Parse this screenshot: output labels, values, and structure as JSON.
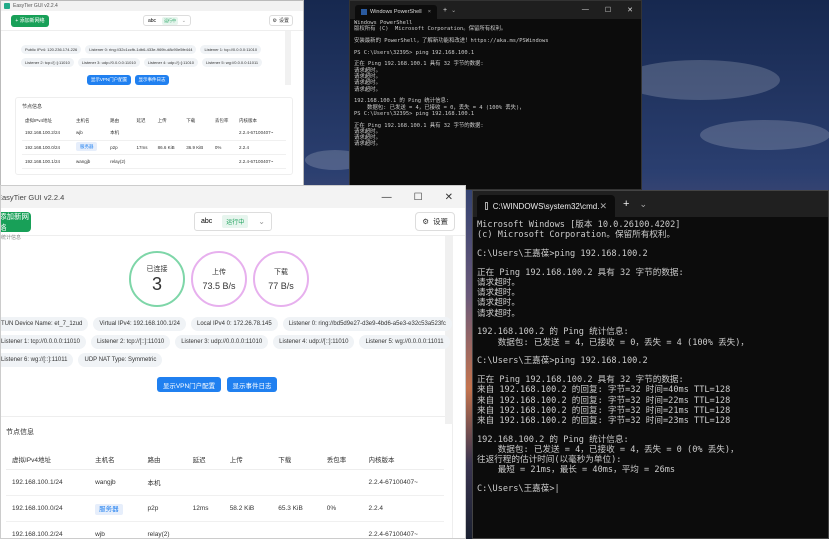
{
  "w1": {
    "title": "EasyTier GUI v2.2.4",
    "add_button": "+ 添加新网络",
    "network": "abc",
    "status": "运行中",
    "settings": "设置",
    "tags_row1": [
      "Public IPv4: 120.236.174.226",
      "Listener 0: ring://32c1ccfb-1db6-433e-969b-d8c90e5fe444",
      "Listener 1: tcp://0.0.0.0:11010"
    ],
    "tags_row2": [
      "Listener 2: tcp://[::]:11010",
      "Listener 3: udp://0.0.0.0:11010",
      "Listener 4: udp://[::]:11010",
      "Listener 5: wg://0.0.0.0:11011"
    ],
    "btn_portal": "显示VPN门户配置",
    "btn_log": "显示事件日志",
    "node_info": "节点信息",
    "headers": [
      "虚拟IPv4地址",
      "主机名",
      "路由",
      "延迟",
      "上传",
      "下载",
      "丢包率",
      "内核版本"
    ],
    "rows": [
      [
        "192.168.100.2/24",
        "wjb",
        "本机",
        "",
        "",
        "",
        "",
        "2.2.4-67100407~"
      ],
      [
        "192.168.100.0/24",
        "服务器",
        "p2p",
        "17ms",
        "86.6 KiB",
        "36.9 KiB",
        "0%",
        "2.2.4"
      ],
      [
        "192.168.100.1/24",
        "wangjb",
        "relay(2)",
        "",
        "",
        "",
        "",
        "2.2.4-67100407~"
      ]
    ]
  },
  "w2": {
    "title": "Windows PowerShell",
    "tab_new": "+",
    "lines": [
      "Windows PowerShell",
      "版权所有 (C)  Microsoft Corporation。保留所有权利。",
      "",
      "安装最新的 PowerShell，了解新功能和改进！https://aka.ms/PSWindows",
      "",
      "PS C:\\Users\\32395> ping 192.168.100.1",
      "",
      "正在 Ping 192.168.100.1 具有 32 字节的数据:",
      "请求超时。",
      "请求超时。",
      "请求超时。",
      "请求超时。",
      "",
      "192.168.100.1 的 Ping 统计信息:",
      "    数据包: 已发送 = 4，已接收 = 0，丢失 = 4 (100% 丢失)，",
      "PS C:\\Users\\32395> ping 192.168.100.1",
      "",
      "正在 Ping 192.168.100.1 具有 32 字节的数据:",
      "请求超时。",
      "请求超时。",
      "请求超时。"
    ]
  },
  "w4": {
    "title": "EasyTier GUI v2.2.4",
    "add_button": "添加新网络",
    "network": "abc",
    "status": "运行中",
    "settings": "设置",
    "stats_label": "统计信息",
    "connected_label": "已连接",
    "connected_value": "3",
    "upload_label": "上传",
    "upload_value": "73.5 B/s",
    "download_label": "下载",
    "download_value": "77 B/s",
    "tags_row1": [
      "TUN Device Name: et_7_1zud",
      "Virtual IPv4: 192.168.100.1/24",
      "Local IPv4 0: 172.26.78.145",
      "Listener 0: ring://bd5d9e27-d3e9-4bd6-a5e3-e32c53a523fc"
    ],
    "tags_row2": [
      "Listener 1: tcp://0.0.0.0:11010",
      "Listener 2: tcp://[::]:11010",
      "Listener 3: udp://0.0.0.0:11010",
      "Listener 4: udp://[::]:11010",
      "Listener 5: wg://0.0.0.0:11011"
    ],
    "tags_row3": [
      "Listener 6: wg://[::]:11011",
      "UDP NAT Type: Symmetric"
    ],
    "btn_portal": "显示VPN门户配置",
    "btn_log": "显示事件日志",
    "node_info": "节点信息",
    "headers": [
      "虚拟IPv4地址",
      "主机名",
      "路由",
      "延迟",
      "上传",
      "下载",
      "丢包率",
      "内核版本"
    ],
    "rows": [
      [
        "192.168.100.1/24",
        "wangjb",
        "本机",
        "",
        "",
        "",
        "",
        "2.2.4-67100407~"
      ],
      [
        "192.168.100.0/24",
        "服务器",
        "p2p",
        "12ms",
        "58.2 KiB",
        "65.3 KiB",
        "0%",
        "2.2.4"
      ],
      [
        "192.168.100.2/24",
        "wjb",
        "relay(2)",
        "",
        "",
        "",
        "",
        "2.2.4-67100407~"
      ]
    ]
  },
  "w3": {
    "title": "C:\\WINDOWS\\system32\\cmd.",
    "tab_new": "+",
    "lines": [
      "Microsoft Windows [版本 10.0.26100.4202]",
      "(c) Microsoft Corporation。保留所有权利。",
      "",
      "C:\\Users\\王嘉葆>ping 192.168.100.2",
      "",
      "正在 Ping 192.168.100.2 具有 32 字节的数据:",
      "请求超时。",
      "请求超时。",
      "请求超时。",
      "请求超时。",
      "",
      "192.168.100.2 的 Ping 统计信息:",
      "    数据包: 已发送 = 4，已接收 = 0，丢失 = 4 (100% 丢失)，",
      "",
      "C:\\Users\\王嘉葆>ping 192.168.100.2",
      "",
      "正在 Ping 192.168.100.2 具有 32 字节的数据:",
      "来自 192.168.100.2 的回复: 字节=32 时间=40ms TTL=128",
      "来自 192.168.100.2 的回复: 字节=32 时间=22ms TTL=128",
      "来自 192.168.100.2 的回复: 字节=32 时间=21ms TTL=128",
      "来自 192.168.100.2 的回复: 字节=32 时间=23ms TTL=128",
      "",
      "192.168.100.2 的 Ping 统计信息:",
      "    数据包: 已发送 = 4，已接收 = 4，丢失 = 0 (0% 丢失)，",
      "往返行程的估计时间(以毫秒为单位):",
      "    最短 = 21ms，最长 = 40ms，平均 = 26ms",
      "",
      "C:\\Users\\王嘉葆>"
    ]
  },
  "colors": {
    "accent_green": "#18a058",
    "accent_blue": "#2080f0",
    "terminal_bg": "#0c0c0c"
  }
}
